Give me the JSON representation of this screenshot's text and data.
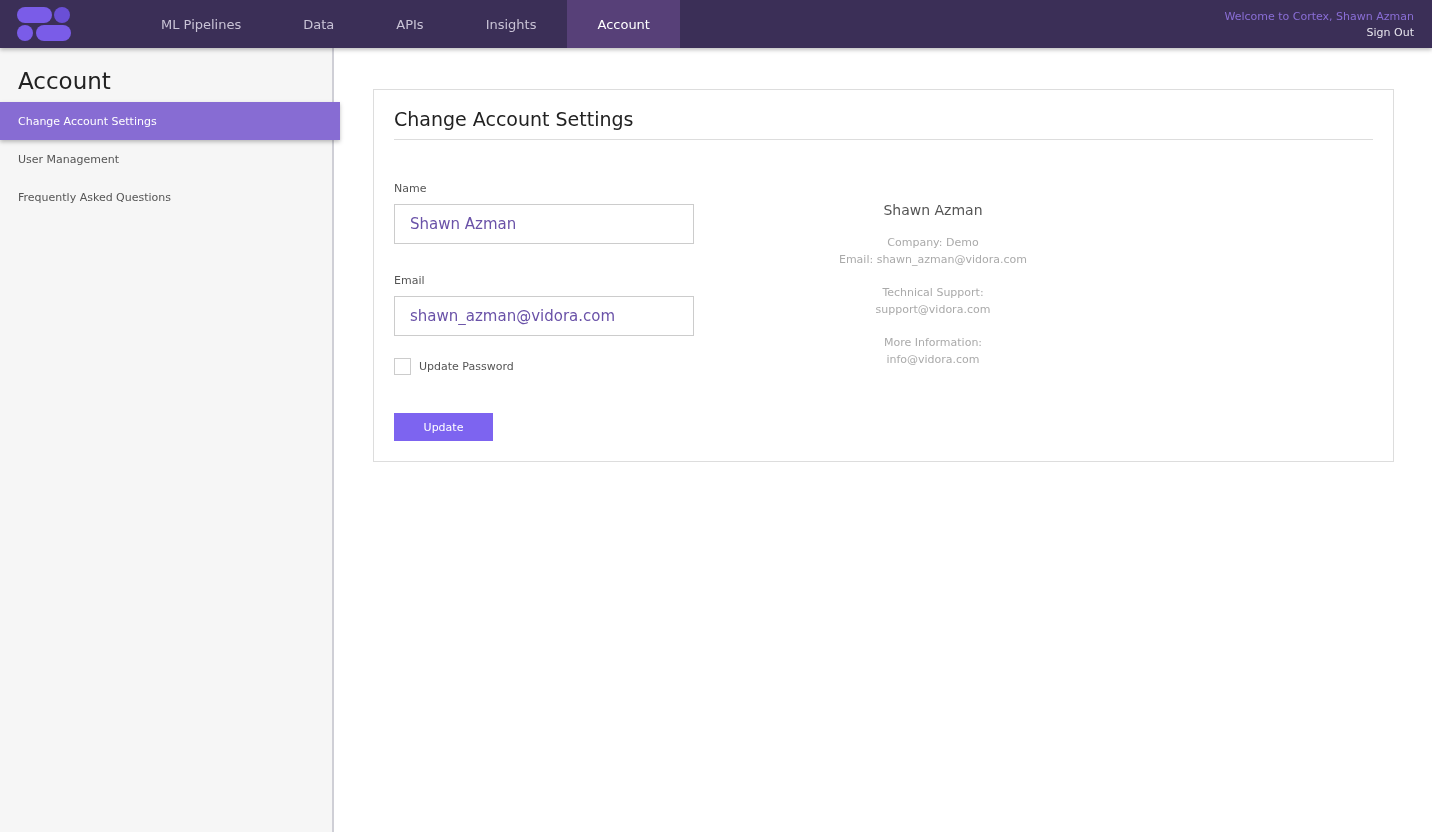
{
  "nav": {
    "tabs": [
      {
        "label": "ML Pipelines",
        "selected": false
      },
      {
        "label": "Data",
        "selected": false
      },
      {
        "label": "APIs",
        "selected": false
      },
      {
        "label": "Insights",
        "selected": false
      },
      {
        "label": "Account",
        "selected": true
      }
    ],
    "welcome": "Welcome to Cortex, Shawn Azman",
    "sign_out": "Sign Out"
  },
  "sidebar": {
    "title": "Account",
    "items": [
      {
        "label": "Change Account Settings",
        "selected": true
      },
      {
        "label": "User Management",
        "selected": false
      },
      {
        "label": "Frequently Asked Questions",
        "selected": false
      }
    ]
  },
  "card": {
    "title": "Change Account Settings",
    "fields": [
      {
        "label": "Name",
        "value": "Shawn Azman"
      },
      {
        "label": "Email",
        "value": "shawn_azman@vidora.com"
      }
    ],
    "update_password": {
      "label": "Update Password",
      "checked": false
    },
    "button": "Update",
    "info": {
      "name": "Shawn Azman",
      "groups": [
        [
          "Company: Demo",
          "Email: shawn_azman@vidora.com"
        ],
        [
          "Technical Support:",
          "support@vidora.com"
        ],
        [
          "More Information:",
          "info@vidora.com"
        ]
      ]
    }
  }
}
